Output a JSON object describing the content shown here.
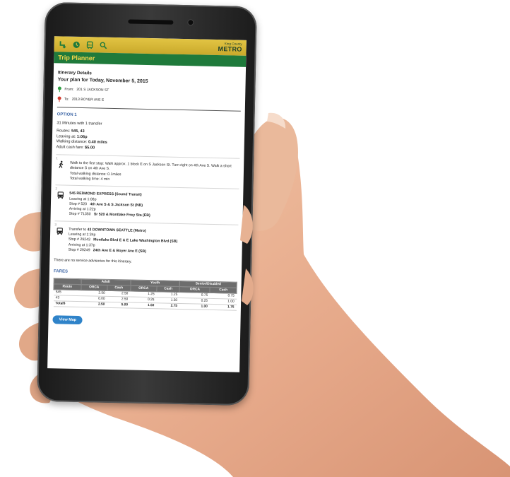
{
  "app": {
    "brand_small": "King County",
    "brand_big": "METRO",
    "page_title": "Trip Planner",
    "nav_icons": [
      "route-icon",
      "clock-icon",
      "bus-icon",
      "search-icon"
    ]
  },
  "itinerary": {
    "heading": "Itinerary Details",
    "plan_title": "Your plan for Today, November 5, 2015",
    "from_label": "From:",
    "from_value": "201 S JACKSON ST",
    "to_label": "To:",
    "to_value": "2013 BOYER AVE E"
  },
  "option": {
    "title": "OPTION 1",
    "duration": "31 Minutes with 1 transfer",
    "routes_label": "Routes:",
    "routes_value": "545, 43",
    "leaving_label": "Leaving at:",
    "leaving_value": "1:06p",
    "walking_label": "Walking distance:",
    "walking_value": "0.40 miles",
    "fare_label": "Adult cash fare:",
    "fare_value": "$5.00"
  },
  "steps": [
    {
      "num": "1",
      "icon": "walk-icon",
      "line1": "Walk to the first stop: Walk approx. 1 block E on S Jackson St. Turn right on 4th Ave S. Walk a short distance S on 4th Ave S.",
      "line2": "Total walking distance: 0.1miles",
      "line3": "Total walking time: 4 min"
    },
    {
      "num": "2",
      "icon": "bus-icon",
      "title": "545 REDMOND EXPRESS (Sound Transit)",
      "line1": "Leaving at 1:08p",
      "stop1_label": "Stop # 520",
      "stop1_name": "4th Ave S & S Jackson St (NB)",
      "line2": "Arriving at 1:22p",
      "stop2_label": "Stop # 71350",
      "stop2_name": "Sr 520 & Montlake Frwy Sta (EB)"
    },
    {
      "num": "3",
      "icon": "bus-icon",
      "prefix": "Transfer to",
      "title": "43 DOWNTOWN SEATTLE (Metro)",
      "line1": "Leaving at 1:34p",
      "stop1_label": "Stop # 29243",
      "stop1_name": "Montlake Blvd E & E Lake Washington Blvd (SB)",
      "line2": "Arriving at 1:37p",
      "stop2_label": "Stop # 29249",
      "stop2_name": "24th Ave E & Boyer Ave E (SB)"
    }
  ],
  "advisory": "There are no service advisories for this itinerary.",
  "fares": {
    "title": "FARES",
    "groups": [
      "Adult",
      "Youth",
      "Senior/Disabled"
    ],
    "columns": [
      "Route",
      "ORCA",
      "Cash",
      "ORCA",
      "Cash",
      "ORCA",
      "Cash"
    ],
    "rows": [
      [
        "545",
        "2.50",
        "2.50",
        "1.25",
        "1.25",
        "0.75",
        "0.75"
      ],
      [
        "43",
        "0.00",
        "2.50",
        "0.25",
        "1.50",
        "0.25",
        "1.00"
      ]
    ],
    "total": [
      "Total$",
      "2.50",
      "5.00",
      "1.50",
      "2.75",
      "1.00",
      "1.75"
    ]
  },
  "view_map": "View Map"
}
